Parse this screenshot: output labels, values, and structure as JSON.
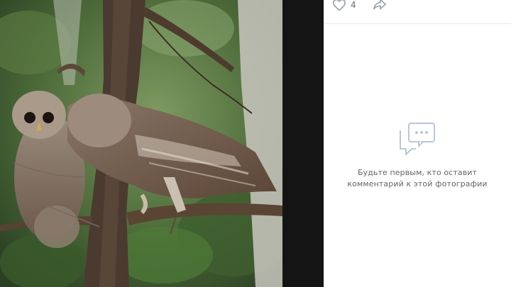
{
  "photo": {
    "subject_icon": "owl-photo"
  },
  "actions": {
    "like_icon": "heart-outline-icon",
    "like_count": "4",
    "share_icon": "share-arrow-icon"
  },
  "comments": {
    "empty_icon": "chat-bubbles-icon",
    "empty_line1": "Будьте первым, кто оставит",
    "empty_line2": "комментарий к этой фотографии"
  },
  "colors": {
    "panel_bg": "#ffffff",
    "muted_text": "#656565",
    "icon_gray": "#99a2ad",
    "accent_icon": "#b8c7d9",
    "backdrop": "#141414"
  }
}
